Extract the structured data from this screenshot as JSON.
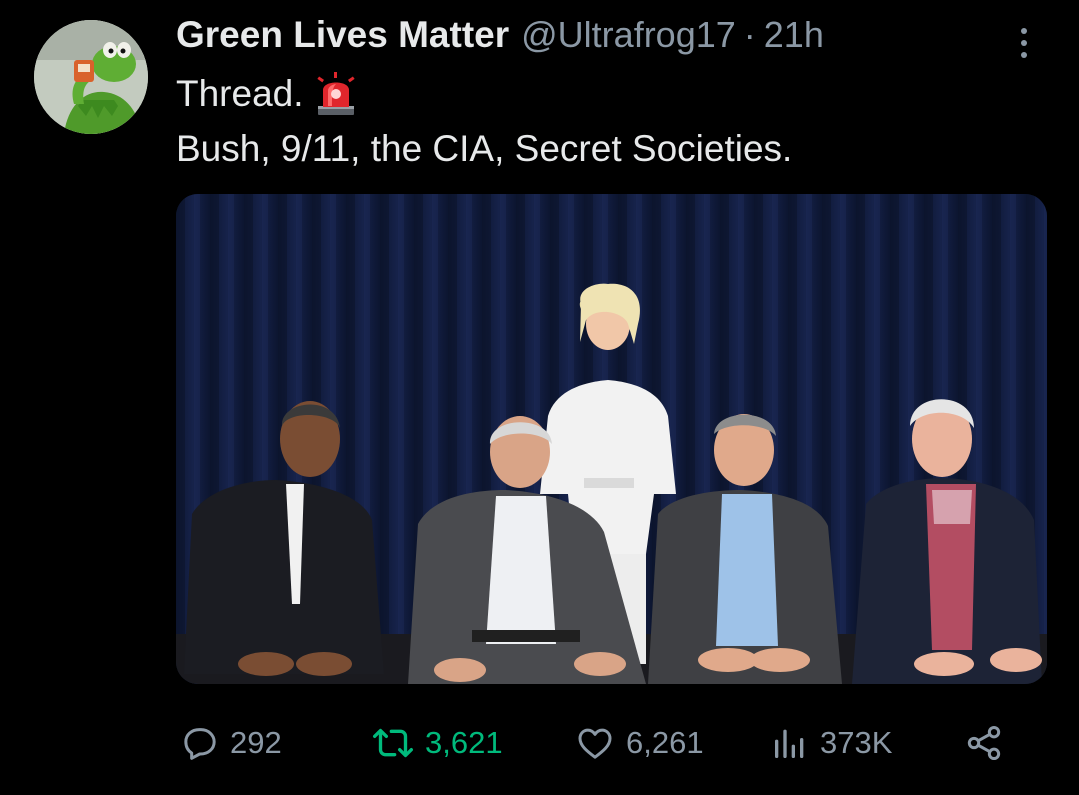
{
  "tweet": {
    "display_name": "Green Lives Matter",
    "handle": "@Ultrafrog17",
    "separator": "·",
    "time": "21h",
    "text_line1": "Thread.",
    "text_line2": "Bush, 9/11, the CIA, Secret Societies.",
    "emoji": "rotating-light-siren-icon"
  },
  "actions": {
    "replies": "292",
    "reposts": "3,621",
    "likes": "6,261",
    "views": "373K"
  },
  "icons": {
    "reply": "speech-bubble-icon",
    "repost": "repost-arrows-icon",
    "like": "heart-icon",
    "views": "bar-chart-icon",
    "share": "share-nodes-icon",
    "more": "vertical-ellipsis-icon"
  },
  "colors": {
    "background": "#000000",
    "text_primary": "#e7e9ea",
    "text_secondary": "#8b98a5",
    "repost_active": "#00ba7c"
  }
}
